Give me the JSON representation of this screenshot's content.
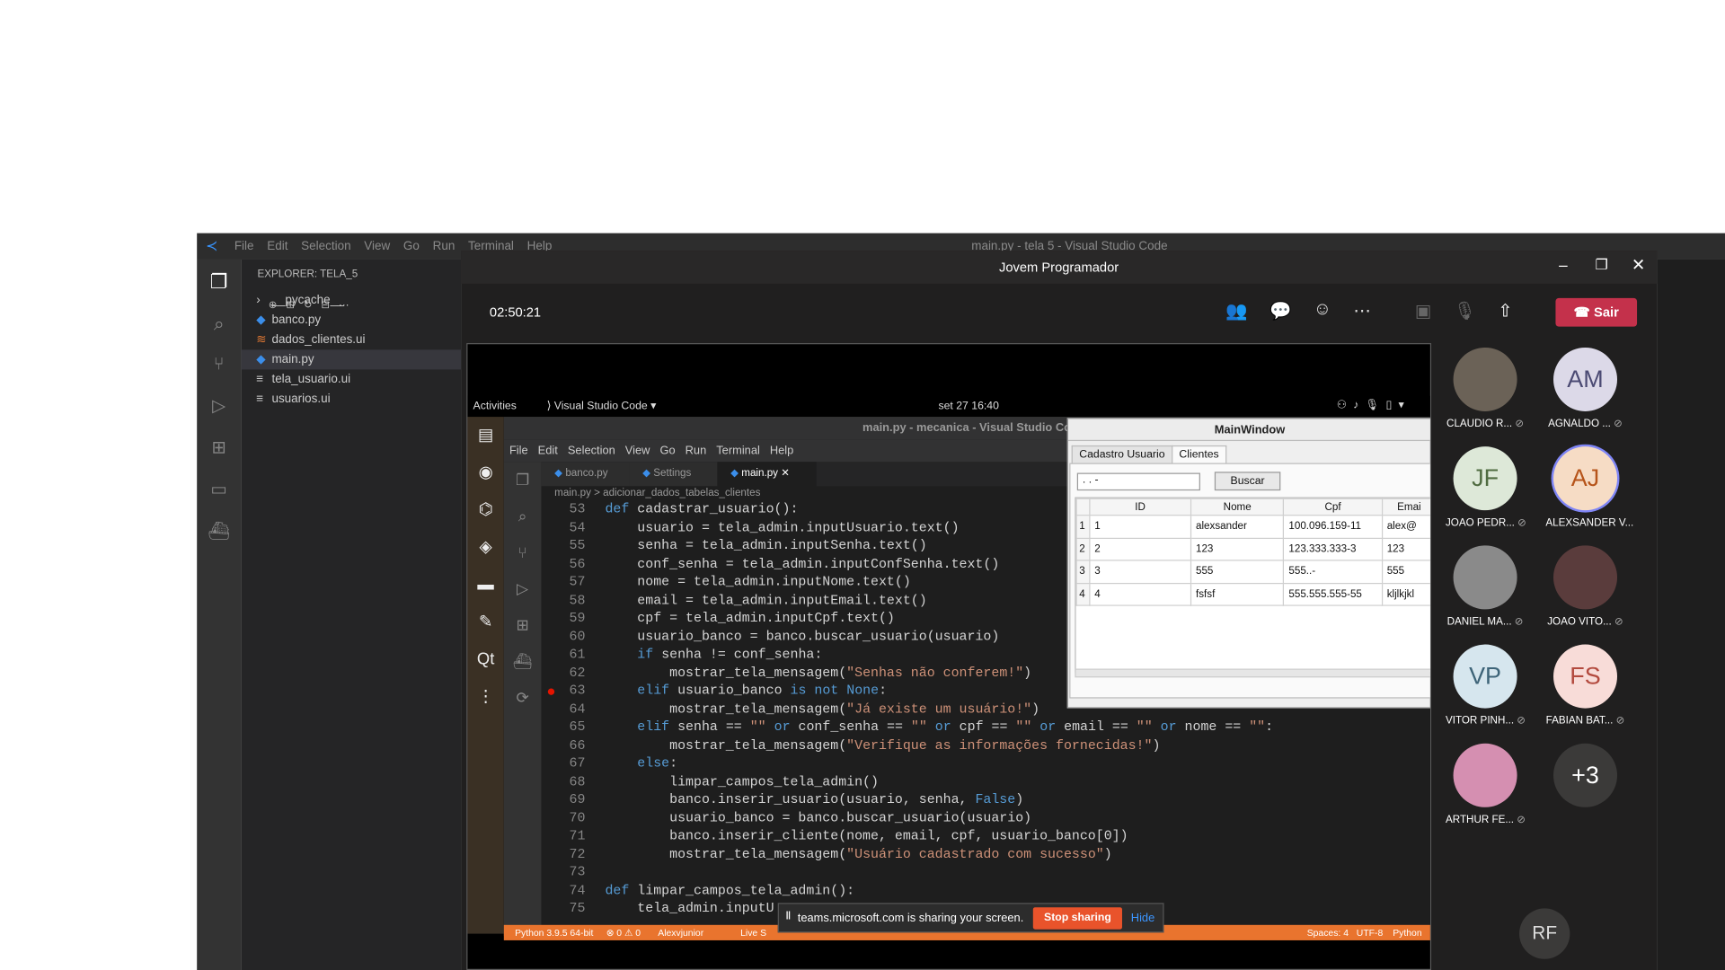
{
  "vscode": {
    "title": "main.py - tela 5 - Visual Studio Code",
    "menu": [
      "File",
      "Edit",
      "Selection",
      "View",
      "Go",
      "Run",
      "Terminal",
      "Help"
    ],
    "explorer_header": "EXPLORER: TELA_5",
    "files": [
      {
        "name": "__pycache__",
        "type": "folder"
      },
      {
        "name": "banco.py",
        "type": "py"
      },
      {
        "name": "dados_clientes.ui",
        "type": "rss"
      },
      {
        "name": "main.py",
        "type": "py",
        "selected": true
      },
      {
        "name": "tela_usuario.ui",
        "type": "ui"
      },
      {
        "name": "usuarios.ui",
        "type": "ui"
      }
    ]
  },
  "teams": {
    "title": "Jovem Programador",
    "timer": "02:50:21",
    "leave_label": "Sair",
    "participants": [
      {
        "name": "CLAUDIO R...",
        "initials": "",
        "photo": true,
        "muted": true
      },
      {
        "name": "AGNALDO ...",
        "initials": "AM",
        "muted": true,
        "bg": "#dcd9e8",
        "fg": "#4b4a73"
      },
      {
        "name": "JOAO PEDR...",
        "initials": "JF",
        "muted": true,
        "bg": "#dde8d8",
        "fg": "#4f6b40"
      },
      {
        "name": "ALEXSANDER V...",
        "initials": "AJ",
        "muted": false,
        "bg": "#f6dcc5",
        "fg": "#b6541a",
        "speaking": true
      },
      {
        "name": "DANIEL MA...",
        "initials": "",
        "photo": true,
        "muted": true
      },
      {
        "name": "JOAO VITO...",
        "initials": "",
        "photo": true,
        "muted": true
      },
      {
        "name": "VITOR PINH...",
        "initials": "VP",
        "muted": true,
        "bg": "#d6e6ee",
        "fg": "#3e6478"
      },
      {
        "name": "FABIAN BAT...",
        "initials": "FS",
        "muted": true,
        "bg": "#f8dcd8",
        "fg": "#b34a3e"
      },
      {
        "name": "ARTHUR FE...",
        "initials": "",
        "photo": true,
        "muted": true
      },
      {
        "name": "",
        "initials": "+3",
        "muted": false,
        "bg": "#3b3a39",
        "fg": "#ffffff"
      }
    ],
    "extra_participant": "RF"
  },
  "shared": {
    "gnome": {
      "activities": "Activities",
      "app": "Visual Studio Code",
      "clock": "set 27  16:40"
    },
    "code_title": "main.py - mecanica - Visual Studio Code",
    "code_menu": [
      "File",
      "Edit",
      "Selection",
      "View",
      "Go",
      "Run",
      "Terminal",
      "Help"
    ],
    "tabs": [
      "banco.py",
      "Settings",
      "main.py"
    ],
    "breadcrumb": "main.py  >  adicionar_dados_tabelas_clientes",
    "code_lines": [
      {
        "n": "53",
        "t": "def cadastrar_usuario():"
      },
      {
        "n": "54",
        "t": "    usuario = tela_admin.inputUsuario.text()"
      },
      {
        "n": "55",
        "t": "    senha = tela_admin.inputSenha.text()"
      },
      {
        "n": "56",
        "t": "    conf_senha = tela_admin.inputConfSenha.text()"
      },
      {
        "n": "57",
        "t": "    nome = tela_admin.inputNome.text()"
      },
      {
        "n": "58",
        "t": "    email = tela_admin.inputEmail.text()"
      },
      {
        "n": "59",
        "t": "    cpf = tela_admin.inputCpf.text()"
      },
      {
        "n": "60",
        "t": "    usuario_banco = banco.buscar_usuario(usuario)"
      },
      {
        "n": "61",
        "t": "    if senha != conf_senha:"
      },
      {
        "n": "62",
        "t": "        mostrar_tela_mensagem(\"Senhas não conferem!\")"
      },
      {
        "n": "63",
        "t": "    elif usuario_banco is not None:"
      },
      {
        "n": "64",
        "t": "        mostrar_tela_mensagem(\"Já existe um usuário!\")"
      },
      {
        "n": "65",
        "t": "    elif senha == \"\" or conf_senha == \"\" or cpf == \"\" or email == \"\" or nome == \"\":"
      },
      {
        "n": "66",
        "t": "        mostrar_tela_mensagem(\"Verifique as informações fornecidas!\")"
      },
      {
        "n": "67",
        "t": "    else:"
      },
      {
        "n": "68",
        "t": "        limpar_campos_tela_admin()"
      },
      {
        "n": "69",
        "t": "        banco.inserir_usuario(usuario, senha, False)"
      },
      {
        "n": "70",
        "t": "        usuario_banco = banco.buscar_usuario(usuario)"
      },
      {
        "n": "71",
        "t": "        banco.inserir_cliente(nome, email, cpf, usuario_banco[0])"
      },
      {
        "n": "72",
        "t": "        mostrar_tela_mensagem(\"Usuário cadastrado com sucesso\")"
      },
      {
        "n": "73",
        "t": ""
      },
      {
        "n": "74",
        "t": "def limpar_campos_tela_admin():"
      },
      {
        "n": "75",
        "t": "    tela_admin.inputU"
      }
    ],
    "qt": {
      "title": "MainWindow",
      "tabs": [
        "Cadastro Usuario",
        "Clientes"
      ],
      "search_value": " .  .  -",
      "search_button": "Buscar",
      "columns": [
        "ID",
        "Nome",
        "Cpf",
        "Emai"
      ],
      "rows": [
        [
          "1",
          "1",
          "alexsander",
          "100.096.159-11",
          "alex@"
        ],
        [
          "2",
          "2",
          "123",
          "123.333.333-3",
          "123"
        ],
        [
          "3",
          "3",
          "555",
          "555..-",
          "555"
        ],
        [
          "4",
          "4",
          "fsfsf",
          "555.555.555-55",
          "kljlkjkl"
        ]
      ]
    },
    "statusbar": {
      "python": "Python 3.9.5 64-bit",
      "problems": "⊗ 0 ⚠ 0",
      "user": "Alexvjunior",
      "live": "Live S",
      "spaces": "Spaces: 4",
      "encoding": "UTF-8",
      "lang": "Python"
    },
    "toast": {
      "text": "teams.microsoft.com is sharing your screen.",
      "stop": "Stop sharing",
      "hide": "Hide"
    }
  }
}
